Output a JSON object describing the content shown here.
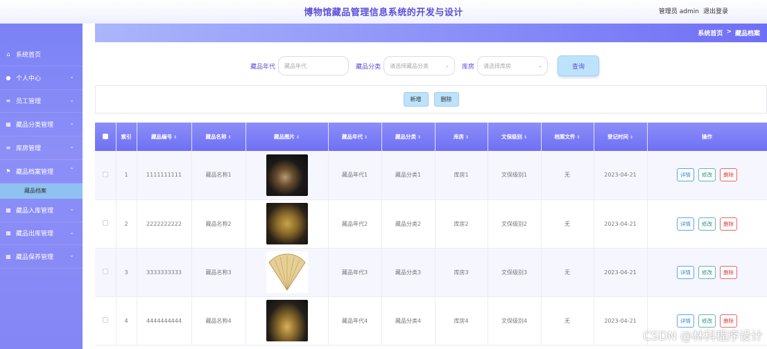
{
  "header": {
    "title": "博物馆藏品管理信息系统的开发与设计",
    "user_label": "管理员 admin",
    "logout": "退出登录"
  },
  "sidebar": {
    "items": [
      {
        "label": "系统首页",
        "icon": "home-icon",
        "chevron": ""
      },
      {
        "label": "个人中心",
        "icon": "user-icon",
        "chevron": "⌄"
      },
      {
        "label": "员工管理",
        "icon": "list-icon",
        "chevron": "⌄"
      },
      {
        "label": "藏品分类管理",
        "icon": "grid-icon",
        "chevron": "⌄"
      },
      {
        "label": "库房管理",
        "icon": "list-icon",
        "chevron": "⌄"
      },
      {
        "label": "藏品档案管理",
        "icon": "flag-icon",
        "chevron": "⌃"
      },
      {
        "label": "藏品入库管理",
        "icon": "grid-icon",
        "chevron": "⌄"
      },
      {
        "label": "藏品出库管理",
        "icon": "grid-icon",
        "chevron": "⌄"
      },
      {
        "label": "藏品保养管理",
        "icon": "grid-icon",
        "chevron": "⌄"
      }
    ],
    "sub_item": "藏品档案"
  },
  "breadcrumb": {
    "home": "系统首页",
    "separator": ">",
    "current": "藏品档案"
  },
  "search": {
    "era_label": "藏品年代",
    "era_placeholder": "藏品年代",
    "category_label": "藏品分类",
    "category_placeholder": "请选择藏品分类",
    "store_label": "库房",
    "store_placeholder": "请选择库房",
    "query_button": "查询"
  },
  "actions": {
    "add": "新增",
    "delete": "删除"
  },
  "table": {
    "headers": {
      "index": "索引",
      "code": "藏品编号",
      "name": "藏品名称",
      "image": "藏品图片",
      "era": "藏品年代",
      "category": "藏品分类",
      "store": "库房",
      "level": "文保级别",
      "file": "档案文件",
      "time": "登记时间",
      "ops": "操作"
    },
    "rows": [
      {
        "index": "1",
        "code": "1111111111",
        "name": "藏品名称1",
        "era": "藏品年代1",
        "category": "藏品分类1",
        "store": "库房1",
        "level": "文保级别1",
        "file": "无",
        "time": "2023-04-21"
      },
      {
        "index": "2",
        "code": "2222222222",
        "name": "藏品名称2",
        "era": "藏品年代2",
        "category": "藏品分类2",
        "store": "库房2",
        "level": "文保级别2",
        "file": "无",
        "time": "2023-04-21"
      },
      {
        "index": "3",
        "code": "3333333333",
        "name": "藏品名称3",
        "era": "藏品年代3",
        "category": "藏品分类3",
        "store": "库房3",
        "level": "文保级别3",
        "file": "无",
        "time": "2023-04-21"
      },
      {
        "index": "4",
        "code": "4444444444",
        "name": "藏品名称4",
        "era": "藏品年代4",
        "category": "藏品分类4",
        "store": "库房4",
        "level": "文保级别4",
        "file": "无",
        "time": "2023-04-21"
      }
    ],
    "op_labels": {
      "detail": "详情",
      "edit": "修改",
      "delete": "删除"
    }
  },
  "watermark": "CSDN @林科程序设计",
  "colors": {
    "accent": "#6f70f4",
    "title": "#5b4fd8",
    "sub_active": "#8fc2f0"
  }
}
